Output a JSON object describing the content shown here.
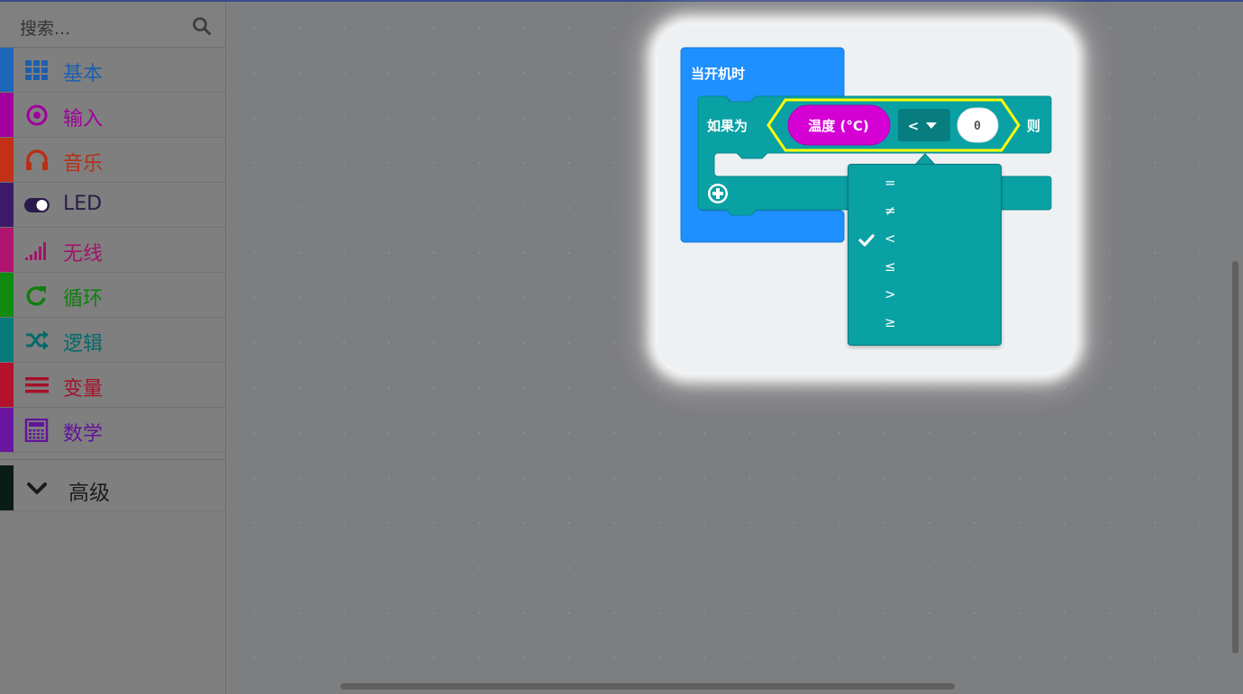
{
  "search": {
    "placeholder": "搜索..."
  },
  "categories": [
    {
      "label": "基本",
      "icon": "grid-icon",
      "color": "#1e66b8",
      "text_color": "#1d5fae"
    },
    {
      "label": "输入",
      "icon": "target-icon",
      "color": "#a1009c",
      "text_color": "#a0009c"
    },
    {
      "label": "音乐",
      "icon": "headphones-icon",
      "color": "#c23016",
      "text_color": "#b72f16"
    },
    {
      "label": "LED",
      "icon": "toggle-icon",
      "color": "#3c1a6a",
      "text_color": "#2a1b4a"
    },
    {
      "label": "无线",
      "icon": "signal-icon",
      "color": "#b0146f",
      "text_color": "#a0146a"
    },
    {
      "label": "循环",
      "icon": "refresh-icon",
      "color": "#118a10",
      "text_color": "#0f7f0f"
    },
    {
      "label": "逻辑",
      "icon": "shuffle-icon",
      "color": "#077a7c",
      "text_color": "#06696b"
    },
    {
      "label": "变量",
      "icon": "list-lines-icon",
      "color": "#b4112c",
      "text_color": "#a5112a"
    },
    {
      "label": "数学",
      "icon": "calculator-icon",
      "color": "#6a159f",
      "text_color": "#62149a"
    }
  ],
  "advanced": {
    "label": "高级",
    "icon": "chevron-down-icon"
  },
  "blocks": {
    "event_label": "当开机时",
    "if_label": "如果为",
    "then_label": "则",
    "sensor_label": "温度 (°C)",
    "operator": "<",
    "value": "0"
  },
  "dropdown": {
    "selected": "<",
    "options": [
      "=",
      "≠",
      "<",
      "≤",
      ">",
      "≥"
    ]
  },
  "colors": {
    "event_block": "#1e90ff",
    "logic_block": "#0aa1a4",
    "sensor_block": "#d400d4",
    "highlight": "#ffff00"
  }
}
